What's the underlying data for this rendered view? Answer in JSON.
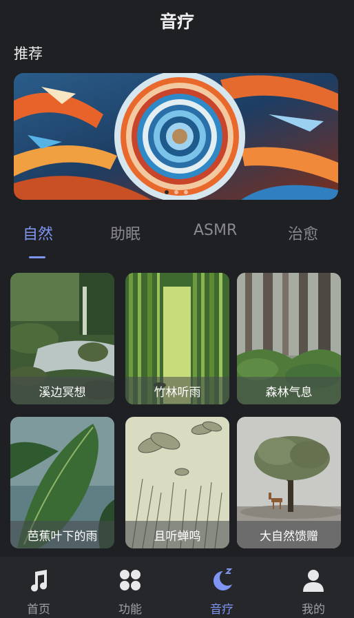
{
  "header": {
    "title": "音疗"
  },
  "recommend": {
    "title": "推荐",
    "banner_dots": 3,
    "active_dot": 0
  },
  "tabs": [
    {
      "label": "自然",
      "active": true
    },
    {
      "label": "助眠",
      "active": false
    },
    {
      "label": "ASMR",
      "active": false
    },
    {
      "label": "治愈",
      "active": false
    }
  ],
  "cards": [
    {
      "label": "溪边冥想"
    },
    {
      "label": "竹林听雨"
    },
    {
      "label": "森林气息"
    },
    {
      "label": "芭蕉叶下的雨"
    },
    {
      "label": "且听蝉鸣"
    },
    {
      "label": "大自然馈赠"
    }
  ],
  "nav": [
    {
      "label": "首页",
      "icon": "music-note-icon",
      "active": false
    },
    {
      "label": "功能",
      "icon": "grid-icon",
      "active": false
    },
    {
      "label": "音疗",
      "icon": "moon-sleep-icon",
      "active": true
    },
    {
      "label": "我的",
      "icon": "user-icon",
      "active": false
    }
  ],
  "colors": {
    "accent": "#7f95f2",
    "background": "#1f2023",
    "navbar": "#26272b"
  }
}
